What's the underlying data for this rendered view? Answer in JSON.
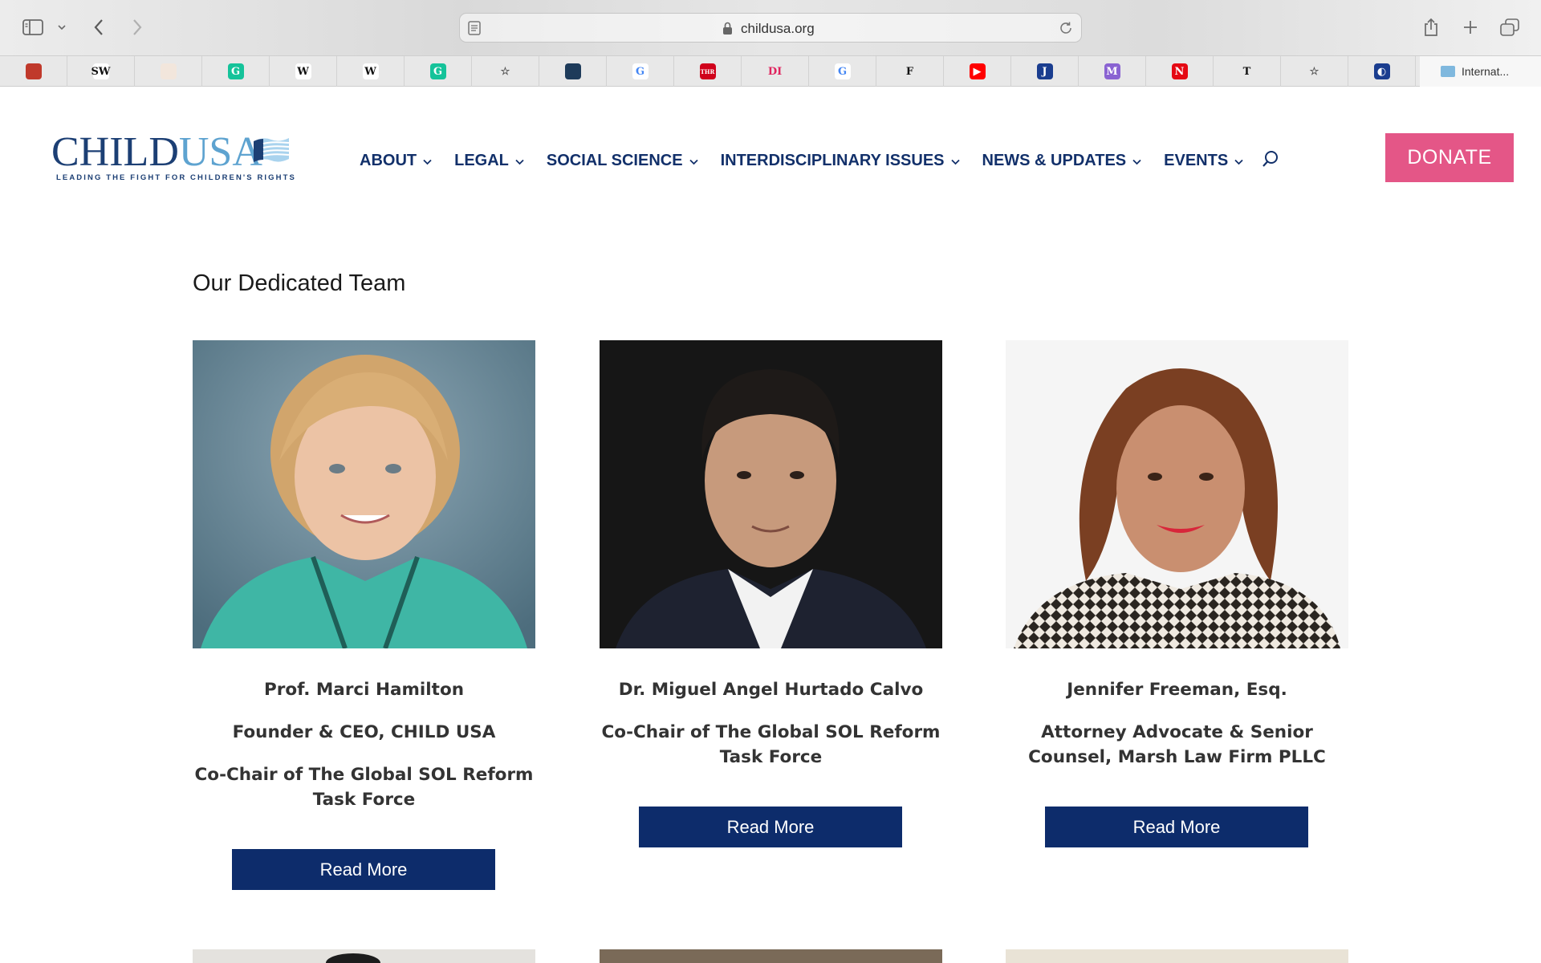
{
  "browser": {
    "url": "childusa.org",
    "favorites": [
      {
        "icon": "red-square-icon",
        "glyph": "",
        "bg": "#c0392b"
      },
      {
        "icon": "sw-logo-icon",
        "glyph": "SW",
        "bg": "#ffffff",
        "fg": "#111111"
      },
      {
        "icon": "rainbow-icon",
        "glyph": "",
        "bg": "#f2e6dc"
      },
      {
        "icon": "grammarly-icon",
        "glyph": "G",
        "bg": "#15c39a"
      },
      {
        "icon": "wikipedia-icon",
        "glyph": "W",
        "bg": "#ffffff",
        "fg": "#111111"
      },
      {
        "icon": "wikipedia-icon",
        "glyph": "W",
        "bg": "#ffffff",
        "fg": "#111111"
      },
      {
        "icon": "grammarly-icon",
        "glyph": "G",
        "bg": "#15c39a"
      },
      {
        "icon": "star-icon",
        "glyph": "☆",
        "bg": "transparent",
        "fg": "#555555"
      },
      {
        "icon": "landscape-icon",
        "glyph": "",
        "bg": "#1e3b5a"
      },
      {
        "icon": "google-icon",
        "glyph": "G",
        "bg": "#ffffff",
        "fg": "#4285f4"
      },
      {
        "icon": "thr-icon",
        "glyph": "THR",
        "bg": "#d0021b"
      },
      {
        "icon": "di-icon",
        "glyph": "DI",
        "bg": "transparent",
        "fg": "#e0245e"
      },
      {
        "icon": "google-icon",
        "glyph": "G",
        "bg": "#ffffff",
        "fg": "#4285f4"
      },
      {
        "icon": "f-logo-icon",
        "glyph": "F",
        "bg": "transparent",
        "fg": "#111111"
      },
      {
        "icon": "youtube-icon",
        "glyph": "▶",
        "bg": "#ff0000"
      },
      {
        "icon": "j-logo-icon",
        "glyph": "J",
        "bg": "#1a3d8f"
      },
      {
        "icon": "m-logo-icon",
        "glyph": "M",
        "bg": "#8a63d2"
      },
      {
        "icon": "n-logo-icon",
        "glyph": "N",
        "bg": "#e50914"
      },
      {
        "icon": "nyt-icon",
        "glyph": "T",
        "bg": "transparent",
        "fg": "#111111"
      },
      {
        "icon": "star-icon",
        "glyph": "☆",
        "bg": "transparent",
        "fg": "#555555"
      },
      {
        "icon": "globe-icon",
        "glyph": "◐",
        "bg": "#1a3d8f"
      }
    ],
    "active_tab": "Internat..."
  },
  "site": {
    "logo_text_child": "CHILD",
    "logo_text_usa": "USA",
    "logo_tagline": "LEADING THE FIGHT FOR CHILDREN'S RIGHTS",
    "nav": [
      {
        "label": "ABOUT"
      },
      {
        "label": "LEGAL"
      },
      {
        "label": "SOCIAL SCIENCE"
      },
      {
        "label": "INTERDISCIPLINARY ISSUES"
      },
      {
        "label": "NEWS & UPDATES"
      },
      {
        "label": "EVENTS"
      }
    ],
    "donate_label": "DONATE"
  },
  "content": {
    "section_title": "Our Dedicated Team",
    "members": [
      {
        "name": "Prof. Marci Hamilton",
        "lines": [
          "Founder & CEO, CHILD USA",
          "Co-Chair of The Global SOL Reform Task Force"
        ],
        "button": "Read More"
      },
      {
        "name": "Dr. Miguel Angel Hurtado Calvo",
        "lines": [
          "Co-Chair of The Global SOL Reform Task Force"
        ],
        "button": "Read More"
      },
      {
        "name": "Jennifer Freeman, Esq.",
        "lines": [
          "Attorney Advocate & Senior Counsel, Marsh Law Firm PLLC"
        ],
        "button": "Read More"
      }
    ]
  },
  "colors": {
    "navy": "#12306a",
    "button_navy": "#0d2c6b",
    "donate_pink": "#e45687",
    "logo_blue": "#5ea3d0"
  }
}
